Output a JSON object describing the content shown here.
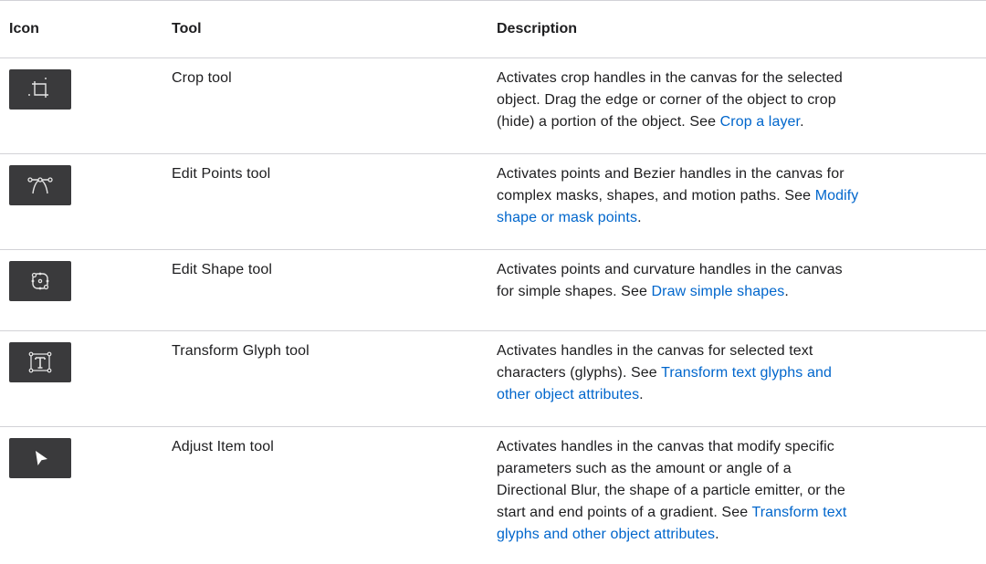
{
  "headers": {
    "icon": "Icon",
    "tool": "Tool",
    "description": "Description"
  },
  "rows": [
    {
      "icon": "crop-icon",
      "tool": "Crop tool",
      "desc_lines": [
        "Activates crop handles in the canvas for the selected",
        "object. Drag the edge or corner of the object to crop",
        "(hide) a portion of the object. See "
      ],
      "link": "Crop a layer",
      "after_link": "."
    },
    {
      "icon": "edit-points-icon",
      "tool": "Edit Points tool",
      "desc_lines": [
        "Activates points and Bezier handles in the canvas for",
        "complex masks, shapes, and motion paths. See "
      ],
      "link_line1": "Modify",
      "link_line2": "shape or mask points",
      "after_link": "."
    },
    {
      "icon": "edit-shape-icon",
      "tool": "Edit Shape tool",
      "desc_lines": [
        "Activates points and curvature handles in the canvas",
        "for simple shapes. See "
      ],
      "link": "Draw simple shapes",
      "after_link": "."
    },
    {
      "icon": "transform-glyph-icon",
      "tool": "Transform Glyph tool",
      "desc_lines": [
        "Activates handles in the canvas for selected text",
        "characters (glyphs). See "
      ],
      "link_line1": "Transform text glyphs and",
      "link_line2": "other object attributes",
      "after_link": "."
    },
    {
      "icon": "adjust-item-icon",
      "tool": "Adjust Item tool",
      "desc_lines": [
        "Activates handles in the canvas that modify specific",
        "parameters such as the amount or angle of a",
        "Directional Blur, the shape of a particle emitter, or the",
        "start and end points of a gradient. See "
      ],
      "link_line1": "Transform text",
      "link_line2": "glyphs and other object attributes",
      "after_link": "."
    }
  ],
  "colors": {
    "link": "#0066cc",
    "icon_bg": "#3a3a3c",
    "divider": "#d2d2d7"
  }
}
